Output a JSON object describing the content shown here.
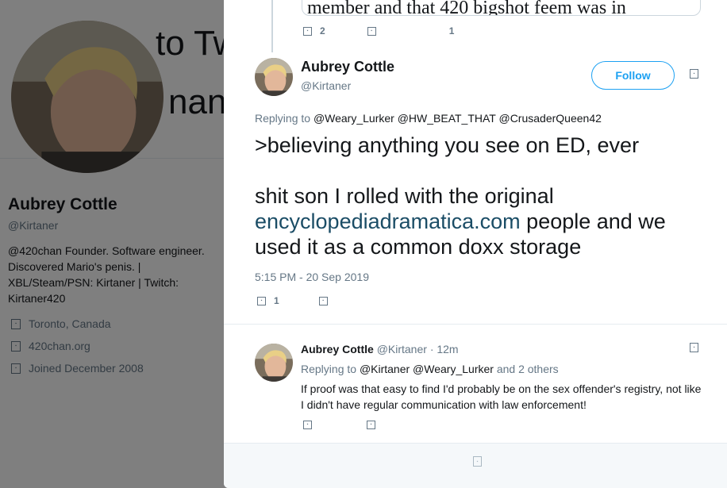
{
  "background_profile": {
    "header_fragment_top": "to Tw",
    "header_fragment_bottom": "nan",
    "name": "Aubrey Cottle",
    "handle": "@Kirtaner",
    "bio": "@420chan Founder. Software engineer. Discovered Mario's penis. | XBL/Steam/PSN: Kirtaner | Twitch: Kirtaner420",
    "location": "Toronto, Canada",
    "website": "420chan.org",
    "joined": "Joined December 2008",
    "icons": [
      "location-icon",
      "link-icon",
      "calendar-icon"
    ]
  },
  "previous_tweet": {
    "quote_fragment": "member and that 420 bigshot feem was in",
    "reply_count": "2",
    "like_count": "1"
  },
  "main_tweet": {
    "name": "Aubrey Cottle",
    "handle": "@Kirtaner",
    "follow_label": "Follow",
    "replying_prefix": "Replying to",
    "replying_mentions": "@Weary_Lurker @HW_BEAT_THAT @CrusaderQueen42",
    "text_line1": ">believing anything you see on ED, ever",
    "text_line2_before": "shit son I rolled with the original ",
    "text_link": "encyclopediadramatica.com",
    "text_line2_after": " people and we used it as a common doxx storage",
    "timestamp": "5:15 PM - 20 Sep 2019",
    "reply_count": "1"
  },
  "reply_tweet": {
    "name": "Aubrey Cottle",
    "handle": "@Kirtaner",
    "time": "· 12m",
    "replying_prefix": "Replying to",
    "replying_mentions": "@Kirtaner @Weary_Lurker",
    "replying_suffix": "and 2 others",
    "text": "If proof was that easy to find I'd probably be on the sex offender's registry, not like I didn't have regular communication with law enforcement!"
  },
  "colors": {
    "accent": "#1da1f2",
    "link": "#1b95e0",
    "muted": "#657786",
    "text": "#14171a",
    "overlay": "rgba(0,0,0,0.5)"
  }
}
